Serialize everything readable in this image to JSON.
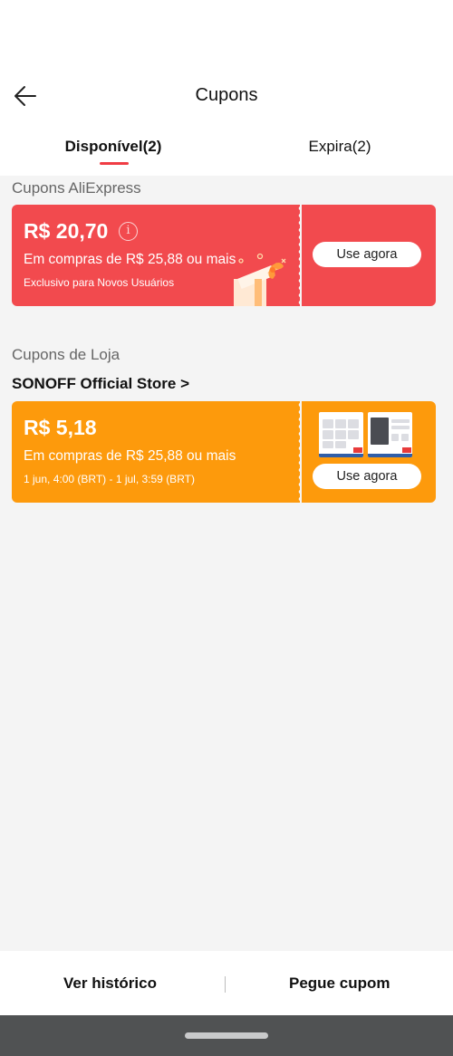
{
  "header": {
    "title": "Cupons",
    "back_icon": "arrow-left-icon"
  },
  "tabs": [
    {
      "label": "Disponível(2)",
      "active": true
    },
    {
      "label": "Expira(2)",
      "active": false
    }
  ],
  "sections": {
    "aliexpress_label": "Cupons AliExpress",
    "store_label": "Cupons de Loja",
    "store_name": "SONOFF Official Store >"
  },
  "coupons": [
    {
      "amount": "R$ 20,70",
      "min_purchase": "Em compras de R$ 25,88 ou mais",
      "note": "Exclusivo para Novos Usuários",
      "button": "Use agora",
      "color": "#f24a4e",
      "icons": [
        "info-icon",
        "gift-icon"
      ]
    },
    {
      "amount": "R$ 5,18",
      "min_purchase": "Em compras de R$ 25,88 ou mais",
      "note": "1 jun, 4:00 (BRT) - 1 jul, 3:59 (BRT)",
      "button": "Use agora",
      "color": "#fd9a0c"
    }
  ],
  "bottom": {
    "history": "Ver histórico",
    "get_coupon": "Pegue cupom"
  },
  "colors": {
    "accent": "#f03c44",
    "page_bg": "#f4f4f4",
    "nav_bg": "#505253"
  }
}
